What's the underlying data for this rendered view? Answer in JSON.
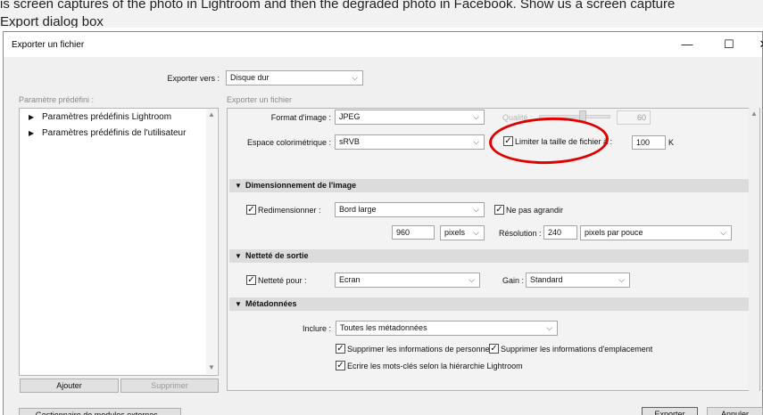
{
  "background_text": {
    "line1": "is screen captures of the photo in Lightroom and then the degraded photo in Facebook. Show us a screen capture",
    "line2": "Export dialog box"
  },
  "window": {
    "title": "Exporter un fichier",
    "controls": {
      "minimize": "—",
      "maximize": "☐",
      "close": "✕"
    }
  },
  "export_to": {
    "label": "Exporter vers :",
    "value": "Disque dur"
  },
  "presets": {
    "header": "Paramètre prédéfini :",
    "items": [
      {
        "label": "Paramètres prédéfinis Lightroom"
      },
      {
        "label": "Paramètres prédéfinis de l'utilisateur"
      }
    ],
    "add_button": "Ajouter",
    "remove_button": "Supprimer",
    "plugin_button": "Gestionnaire de modules externes..."
  },
  "export_panel_header": "Exporter un fichier",
  "file_settings": {
    "format_label": "Format d'image :",
    "format_value": "JPEG",
    "quality_label": "Qualité :",
    "quality_value": "60",
    "quality_fraction": 0.6,
    "colorspace_label": "Espace colorimétrique :",
    "colorspace_value": "sRVB",
    "limit_label": "Limiter la taille de fichier à :",
    "limit_checked": true,
    "limit_value": "100",
    "limit_unit": "K"
  },
  "sizing": {
    "title": "Dimensionnement de l'image",
    "resize_label": "Redimensionner :",
    "resize_checked": true,
    "resize_mode": "Bord large",
    "no_enlarge_label": "Ne pas agrandir",
    "no_enlarge_checked": true,
    "size_value": "960",
    "size_unit": "pixels",
    "resolution_label": "Résolution :",
    "resolution_value": "240",
    "resolution_unit": "pixels par pouce"
  },
  "sharpening": {
    "title": "Netteté de sortie",
    "sharpen_label": "Netteté pour :",
    "sharpen_checked": true,
    "sharpen_value": "Ecran",
    "amount_label": "Gain :",
    "amount_value": "Standard"
  },
  "metadata": {
    "title": "Métadonnées",
    "include_label": "Inclure :",
    "include_value": "Toutes les métadonnées",
    "remove_person_label": "Supprimer les informations de personne",
    "remove_person_checked": true,
    "remove_location_label": "Supprimer les informations d'emplacement",
    "remove_location_checked": true,
    "hierarchy_label": "Ecrire les mots-clés selon la hiérarchie Lightroom",
    "hierarchy_checked": true
  },
  "footer": {
    "export_button": "Exporter",
    "cancel_button": "Annuler"
  },
  "icons": {
    "dropdown": "chevron-down-icon",
    "expand": "triangle-right-icon",
    "collapse": "triangle-down-icon",
    "checkmark": "✓"
  },
  "colors": {
    "annotation": "#e00000",
    "section_header": "#dcdcdc",
    "window_bg": "#f0f0f0"
  }
}
